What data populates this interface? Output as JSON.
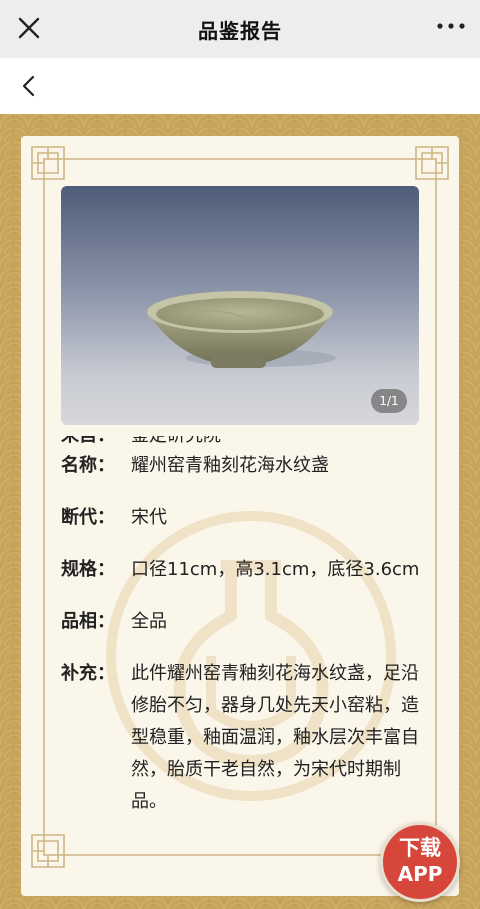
{
  "header": {
    "title": "品鉴报告"
  },
  "photo": {
    "counter": "1/1"
  },
  "info": {
    "partial_row": {
      "label": "来自：",
      "value": "鉴定研究院"
    },
    "rows": [
      {
        "label": "名称：",
        "value": "耀州窑青釉刻花海水纹盏"
      },
      {
        "label": "断代：",
        "value": "宋代"
      },
      {
        "label": "规格：",
        "value": "口径11cm，高3.1cm，底径3.6cm"
      },
      {
        "label": "品相：",
        "value": "全品"
      },
      {
        "label": "补充：",
        "value": "此件耀州窑青釉刻花海水纹盏，足沿修胎不匀，器身几处先天小窑粘，造型稳重，釉面温润，釉水层次丰富自然，胎质干老自然，为宋代时期制品。"
      }
    ]
  },
  "download": {
    "line1": "下载",
    "line2": "APP"
  },
  "colors": {
    "frame": "#c7a45b",
    "card": "#fbf6ea",
    "badge": "#d6463b"
  }
}
